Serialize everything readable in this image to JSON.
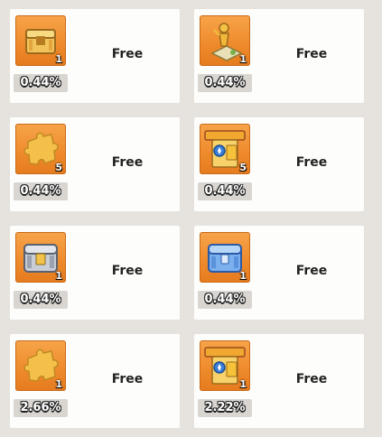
{
  "rewards": [
    {
      "icon": "gold-chest-icon",
      "quantity": "1",
      "percent": "0.44%",
      "price": "Free"
    },
    {
      "icon": "golden-trophy-map-icon",
      "quantity": "1",
      "percent": "0.44%",
      "price": "Free"
    },
    {
      "icon": "puzzle-piece-icon",
      "quantity": "5",
      "percent": "0.44%",
      "price": "Free"
    },
    {
      "icon": "level-book-icon",
      "quantity": "5",
      "percent": "0.44%",
      "price": "Free"
    },
    {
      "icon": "silver-chest-icon",
      "quantity": "1",
      "percent": "0.44%",
      "price": "Free"
    },
    {
      "icon": "blue-chest-icon",
      "quantity": "1",
      "percent": "0.44%",
      "price": "Free"
    },
    {
      "icon": "puzzle-piece-icon",
      "quantity": "1",
      "percent": "2.66%",
      "price": "Free"
    },
    {
      "icon": "level-book-icon",
      "quantity": "1",
      "percent": "2.22%",
      "price": "Free"
    }
  ],
  "colors": {
    "tile_orange": "#ee8a2b",
    "gold": "#f2b83a",
    "background": "#e6e3de"
  }
}
